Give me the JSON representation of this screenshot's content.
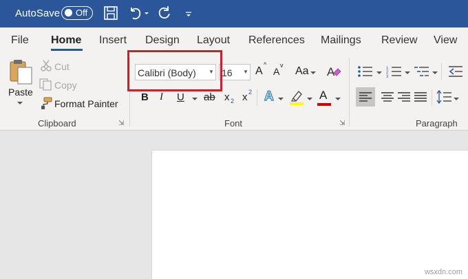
{
  "titlebar": {
    "autosave_label": "AutoSave",
    "autosave_state": "Off"
  },
  "tabs": [
    "File",
    "Home",
    "Insert",
    "Design",
    "Layout",
    "References",
    "Mailings",
    "Review",
    "View"
  ],
  "clipboard": {
    "paste": "Paste",
    "cut": "Cut",
    "copy": "Copy",
    "format_painter": "Format Painter",
    "group_label": "Clipboard"
  },
  "font": {
    "font_name": "Calibri (Body)",
    "font_size": "16",
    "change_case": "Aa",
    "bold": "B",
    "italic": "I",
    "underline": "U",
    "strikethrough": "ab",
    "subscript": "x",
    "subscript_mark": "2",
    "superscript": "x",
    "superscript_mark": "2",
    "grow": "A",
    "shrink": "A",
    "text_effects": "A",
    "font_color": "A",
    "group_label": "Font"
  },
  "paragraph": {
    "group_label": "Paragraph"
  },
  "colors": {
    "title_bar": "#2b579a",
    "highlight_color": "#ffff00",
    "font_color": "#d40000",
    "annotation_box": "#c8202f"
  },
  "watermark": "wsxdn.com"
}
